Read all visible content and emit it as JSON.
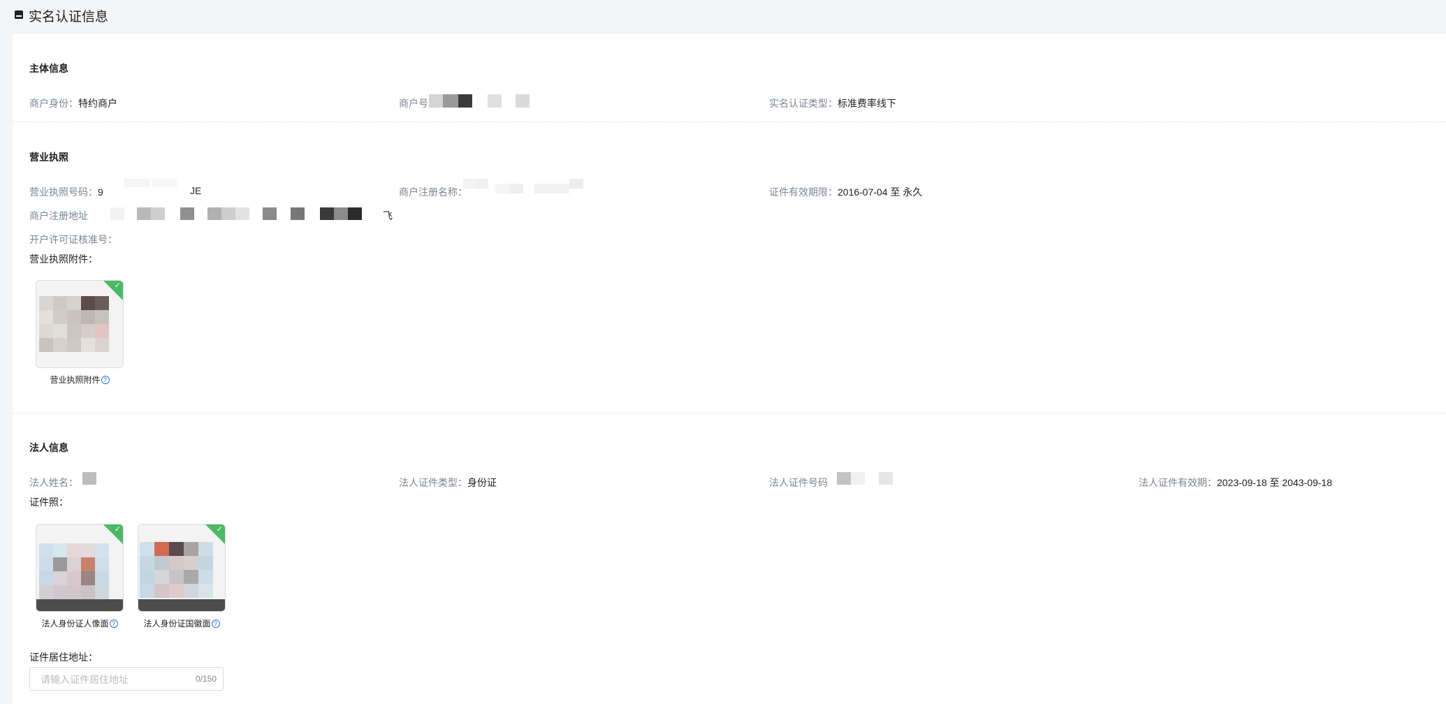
{
  "page": {
    "title": "实名认证信息"
  },
  "subject_section": {
    "title": "主体信息",
    "merchant_identity_label": "商户身份：",
    "merchant_identity_value": "特约商户",
    "merchant_no_label": "商户号",
    "real_name_type_label": "实名认证类型：",
    "real_name_type_value": "标准费率线下"
  },
  "license_section": {
    "title": "营业执照",
    "license_no_label": "营业执照号码：",
    "license_no_prefix": "9",
    "license_no_suffix": "JE",
    "registered_name_label": "商户注册名称：",
    "validity_label": "证件有效期限：",
    "validity_value": "2016-07-04 至 永久",
    "registered_address_label": "商户注册地址",
    "registered_address_tail": "飞",
    "account_permit_label": "开户许可证核准号：",
    "attachment_label": "营业执照附件：",
    "attachment_caption": "营业执照附件"
  },
  "legal_section": {
    "title": "法人信息",
    "name_label": "法人姓名：",
    "id_type_label": "法人证件类型：",
    "id_type_value": "身份证",
    "id_no_label": "法人证件号码",
    "id_validity_label": "法人证件有效期：",
    "id_validity_value": "2023-09-18 至 2043-09-18",
    "id_photo_label": "证件照：",
    "portrait_caption": "法人身份证人像面",
    "emblem_caption": "法人身份证国徽面",
    "address_label": "证件居住地址：",
    "address_placeholder": "请输入证件居住地址",
    "address_counter": "0/150"
  },
  "colors": {
    "accent_green": "#4cb964",
    "help_blue": "#2f6fdf",
    "label_gray": "#7d8592"
  },
  "icons": {
    "header": "store-icon",
    "approved": "check-icon",
    "help": "question-circle-icon"
  }
}
